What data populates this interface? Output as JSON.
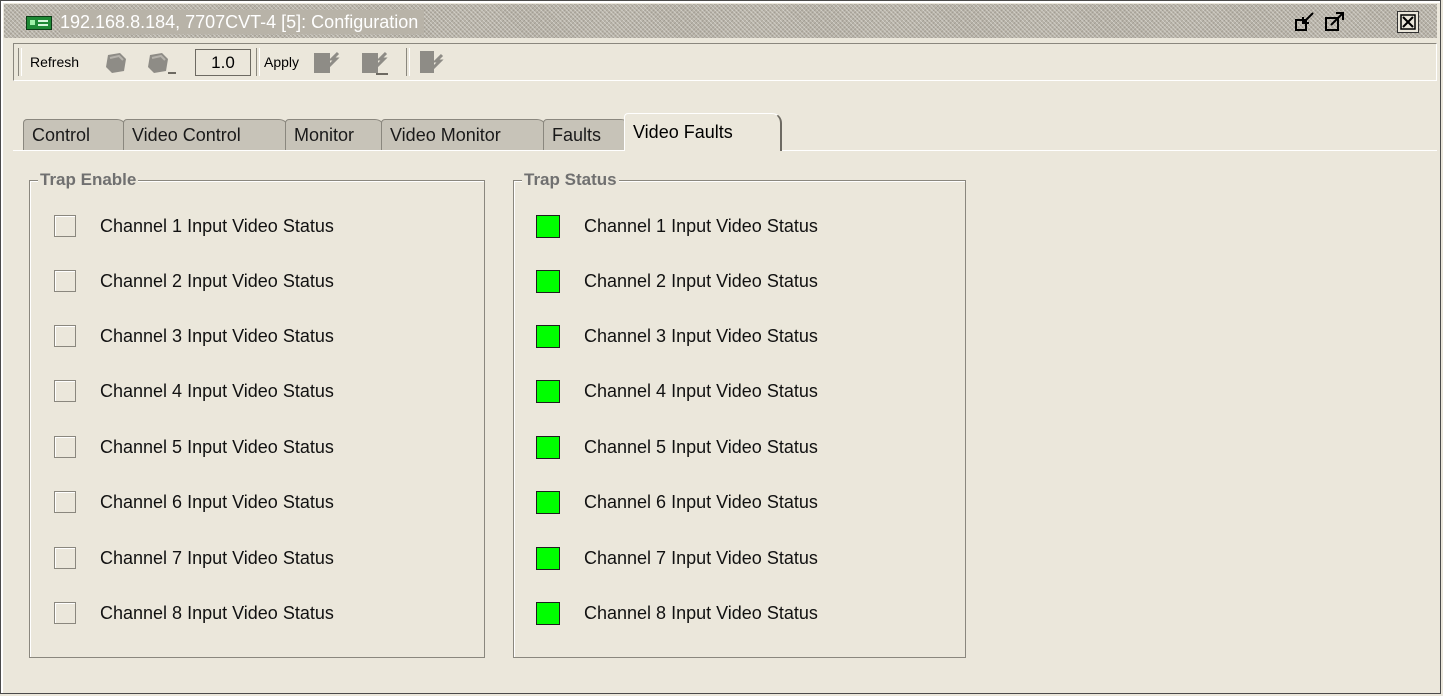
{
  "window": {
    "title": "192.168.8.184, 7707CVT-4  [5]: Configuration",
    "colors": {
      "title_text": "#ffffff",
      "background": "#ebe7db",
      "led_ok": "#00ff00"
    }
  },
  "toolbar": {
    "refresh_label": "Refresh",
    "interval_value": "1.0",
    "apply_label": "Apply",
    "icons": [
      "refresh-icon",
      "auto-refresh-icon",
      "apply-icon",
      "apply-all-icon",
      "apply-auto-icon"
    ]
  },
  "tabs": [
    {
      "label": "Control",
      "active": false
    },
    {
      "label": "Video Control",
      "active": false
    },
    {
      "label": "Monitor",
      "active": false
    },
    {
      "label": "Video Monitor",
      "active": false
    },
    {
      "label": "Faults",
      "active": false
    },
    {
      "label": "Video Faults",
      "active": true
    }
  ],
  "trap_enable": {
    "title": "Trap Enable",
    "items": [
      {
        "label": "Channel 1 Input Video Status",
        "checked": false
      },
      {
        "label": "Channel 2 Input Video Status",
        "checked": false
      },
      {
        "label": "Channel 3 Input Video Status",
        "checked": false
      },
      {
        "label": "Channel 4 Input Video Status",
        "checked": false
      },
      {
        "label": "Channel 5 Input Video Status",
        "checked": false
      },
      {
        "label": "Channel 6 Input Video Status",
        "checked": false
      },
      {
        "label": "Channel 7 Input Video Status",
        "checked": false
      },
      {
        "label": "Channel 8 Input Video Status",
        "checked": false
      }
    ]
  },
  "trap_status": {
    "title": "Trap Status",
    "items": [
      {
        "label": "Channel 1 Input Video Status",
        "status_color": "#00ff00"
      },
      {
        "label": "Channel 2 Input Video Status",
        "status_color": "#00ff00"
      },
      {
        "label": "Channel 3 Input Video Status",
        "status_color": "#00ff00"
      },
      {
        "label": "Channel 4 Input Video Status",
        "status_color": "#00ff00"
      },
      {
        "label": "Channel 5 Input Video Status",
        "status_color": "#00ff00"
      },
      {
        "label": "Channel 6 Input Video Status",
        "status_color": "#00ff00"
      },
      {
        "label": "Channel 7 Input Video Status",
        "status_color": "#00ff00"
      },
      {
        "label": "Channel 8 Input Video Status",
        "status_color": "#00ff00"
      }
    ]
  }
}
